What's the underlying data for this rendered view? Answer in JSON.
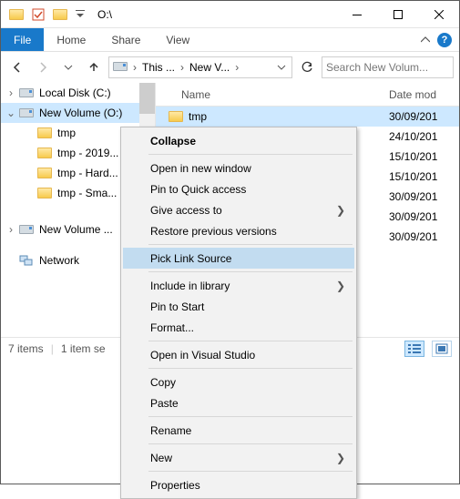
{
  "titlebar": {
    "title": "O:\\"
  },
  "ribbon": {
    "file": "File",
    "tabs": [
      "Home",
      "Share",
      "View"
    ]
  },
  "nav": {
    "breadcrumb": [
      "This ...",
      "New V..."
    ],
    "search_placeholder": "Search New Volum..."
  },
  "tree": {
    "items": [
      {
        "label": "Local Disk (C:)",
        "indent": 0,
        "twisty": "›",
        "icon": "drive"
      },
      {
        "label": "New Volume (O:)",
        "indent": 0,
        "twisty": "⌄",
        "icon": "drive",
        "selected": true
      },
      {
        "label": "tmp",
        "indent": 1,
        "twisty": "",
        "icon": "folder"
      },
      {
        "label": "tmp - 2019...",
        "indent": 1,
        "twisty": "",
        "icon": "folder"
      },
      {
        "label": "tmp - Hard...",
        "indent": 1,
        "twisty": "",
        "icon": "folder"
      },
      {
        "label": "tmp - Sma...",
        "indent": 1,
        "twisty": "",
        "icon": "folder"
      },
      {
        "label": "New Volume ...",
        "indent": 0,
        "twisty": "›",
        "icon": "drive"
      },
      {
        "label": "Network",
        "indent": 0,
        "twisty": "",
        "icon": "net"
      }
    ]
  },
  "files": {
    "columns": [
      "Name",
      "Date mod"
    ],
    "rows": [
      {
        "name": "tmp",
        "date": "30/09/201",
        "selected": true
      },
      {
        "name": "",
        "date": "24/10/201"
      },
      {
        "name": "",
        "date": "15/10/201"
      },
      {
        "name": "",
        "date": "15/10/201"
      },
      {
        "name": "",
        "date": "30/09/201"
      },
      {
        "name": "",
        "date": "30/09/201"
      },
      {
        "name": "",
        "date": "30/09/201"
      }
    ]
  },
  "status": {
    "count": "7 items",
    "sel": "1 item se"
  },
  "context_menu": {
    "items": [
      {
        "label": "Collapse",
        "bold": true
      },
      {
        "sep": true
      },
      {
        "label": "Open in new window"
      },
      {
        "label": "Pin to Quick access"
      },
      {
        "label": "Give access to",
        "submenu": true
      },
      {
        "label": "Restore previous versions"
      },
      {
        "sep": true
      },
      {
        "label": "Pick Link Source",
        "hover": true
      },
      {
        "sep": true
      },
      {
        "label": "Include in library",
        "submenu": true
      },
      {
        "label": "Pin to Start"
      },
      {
        "label": "Format..."
      },
      {
        "sep": true
      },
      {
        "label": "Open in Visual Studio"
      },
      {
        "sep": true
      },
      {
        "label": "Copy"
      },
      {
        "label": "Paste"
      },
      {
        "sep": true
      },
      {
        "label": "Rename"
      },
      {
        "sep": true
      },
      {
        "label": "New",
        "submenu": true
      },
      {
        "sep": true
      },
      {
        "label": "Properties"
      }
    ]
  }
}
